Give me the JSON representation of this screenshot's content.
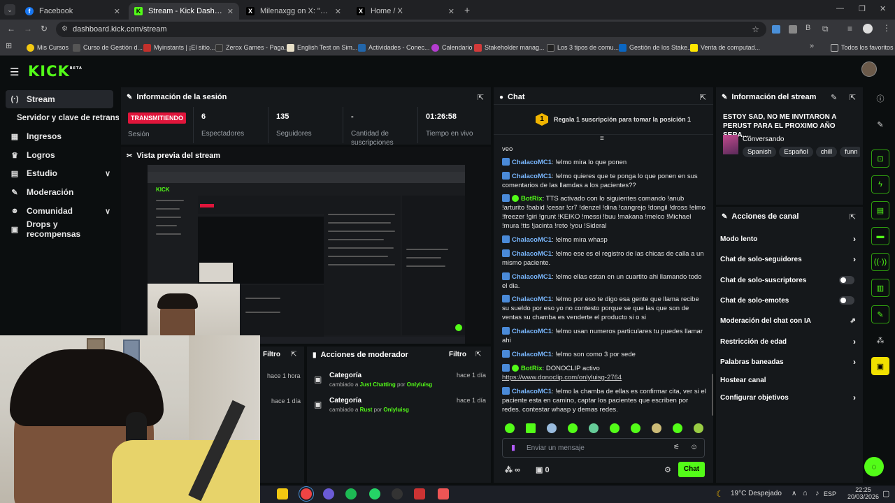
{
  "browser": {
    "tabs": [
      {
        "title": "Facebook",
        "color": "#1877f2",
        "glyph": "f"
      },
      {
        "title": "Stream - Kick Dashboard",
        "color": "#53fc18",
        "glyph": "K"
      },
      {
        "title": "Milenaxgg on X: \"Entrevista al...",
        "color": "#000000",
        "glyph": "X"
      },
      {
        "title": "Home / X",
        "color": "#000000",
        "glyph": "X"
      }
    ],
    "url": "dashboard.kick.com/stream",
    "bookmarks": [
      {
        "label": "Mis Cursos",
        "color": "#f2c811"
      },
      {
        "label": "Curso de Gestión d...",
        "color": "#555555"
      },
      {
        "label": "Myinstants | ¡El sitio...",
        "color": "#c4302b"
      },
      {
        "label": "Zerox Games - Paga...",
        "color": "#333333"
      },
      {
        "label": "English Test on Sim...",
        "color": "#e8e0c8"
      },
      {
        "label": "Actividades - Conec...",
        "color": "#2266aa"
      },
      {
        "label": "Calendario",
        "color": "#b43cd0"
      },
      {
        "label": "Stakeholder manag...",
        "color": "#d23a3a"
      },
      {
        "label": "Los 3 tipos de comu...",
        "color": "#222222"
      },
      {
        "label": "Gestión de los Stake...",
        "color": "#0a66c2"
      },
      {
        "label": "Venta de computad...",
        "color": "#ffe600"
      }
    ],
    "all_favorites": "Todos los favoritos"
  },
  "kick": {
    "logo": "KICK",
    "logo_badge": "BETA"
  },
  "sidebar": {
    "items": [
      {
        "label": "Stream",
        "icon": "(·)"
      },
      {
        "label": "Servidor y clave de retransmisión",
        "icon": ""
      },
      {
        "label": "Ingresos",
        "icon": "▦"
      },
      {
        "label": "Logros",
        "icon": "♛"
      },
      {
        "label": "Estudio",
        "icon": "▤"
      },
      {
        "label": "Moderación",
        "icon": "✎"
      },
      {
        "label": "Comunidad",
        "icon": "☻"
      },
      {
        "label": "Drops y recompensas",
        "icon": "▣"
      }
    ]
  },
  "session": {
    "title": "Información de la sesión",
    "status": "TRANSMITIENDO",
    "status_label": "Sesión",
    "stats": [
      {
        "value": "6",
        "label": "Espectadores"
      },
      {
        "value": "135",
        "label": "Seguidores"
      },
      {
        "value": "-",
        "label": "Cantidad de suscripciones"
      },
      {
        "value": "01:26:58",
        "label": "Tiempo en vivo"
      }
    ]
  },
  "preview": {
    "title": "Vista previa del stream"
  },
  "activity": {
    "filter": "Filtro",
    "times": [
      "hace 1 hora",
      "hace 1 día"
    ]
  },
  "mod_actions": {
    "title": "Acciones de moderador",
    "filter": "Filtro",
    "items": [
      {
        "title": "Categoría",
        "pre": "cambiado a",
        "category": "Just Chatting",
        "by": "por",
        "user": "Onlyluisg",
        "time": "hace 1 día"
      },
      {
        "title": "Categoría",
        "pre": "cambiado a",
        "category": "Rust",
        "by": "por",
        "user": "Onlyluisg",
        "time": "hace 1 día"
      }
    ]
  },
  "chat": {
    "title": "Chat",
    "gift_count": "1",
    "gift_text": "Regala 1 suscripción para tomar la posición 1",
    "first_fragment": "veo",
    "messages": [
      {
        "user": "ChalacoMC1",
        "bot": false,
        "text": ": !elmo mira lo que ponen"
      },
      {
        "user": "ChalacoMC1",
        "bot": false,
        "text": ": !elmo quieres que te ponga lo que ponen en sus comentarios de las llamdas a los pacientes??"
      },
      {
        "user": "BotRix",
        "bot": true,
        "text": ": TTS activado con lo siguientes comando !anub !arturito !babid !cesar !cr7 !denzel !dina !cangrejo !dongil !dross !elmo !freezer !giri !grunt !KEIKO !messi !buu !makana !melco !Michael !mura !tts !jacinta !reto !you !Sideral"
      },
      {
        "user": "ChalacoMC1",
        "bot": false,
        "text": ": !elmo mira whasp"
      },
      {
        "user": "ChalacoMC1",
        "bot": false,
        "text": ": !elmo ese es el registro de las chicas de calla a un mismo paciente."
      },
      {
        "user": "ChalacoMC1",
        "bot": false,
        "text": ": !elmo ellas estan en un cuartito ahi llamando todo el dia."
      },
      {
        "user": "ChalacoMC1",
        "bot": false,
        "text": ": !elmo por eso te digo esa gente que llama recibe su sueldo por eso yo no contesto porque se que las que son de ventas su chamba es venderte el producto si o si"
      },
      {
        "user": "ChalacoMC1",
        "bot": false,
        "text": ": !elmo usan numeros particulares tu puedes llamar ahi"
      },
      {
        "user": "ChalacoMC1",
        "bot": false,
        "text": ": !elmo son como 3 por sede"
      },
      {
        "user": "BotRix",
        "bot": true,
        "text": ": DONOCLIP activo",
        "link": "https://www.donoclip.com/onlyluisg-2764"
      },
      {
        "user": "ChalacoMC1",
        "bot": false,
        "text": ": !elmo la chamba de ellas es confirmar cita, ver si el paciente esta en camino, captar los pacientes que escriben por redes. contestar whasp y demas redes."
      }
    ],
    "input_placeholder": "Enviar un mensaje",
    "points": "∞",
    "gift_points": "0",
    "send_label": "Chat"
  },
  "stream_info": {
    "title": "Información del stream",
    "stream_title": "ESTOY SAD, NO ME INVITARON A PERUST PARA EL PROXIMO AÑO SERA.…",
    "category": "Conversando",
    "tags": [
      "Spanish",
      "Español",
      "chill",
      "funn"
    ]
  },
  "channel_actions": {
    "title": "Acciones de canal",
    "items": [
      {
        "label": "Modo lento",
        "kind": "arrow"
      },
      {
        "label": "Chat de solo-seguidores",
        "kind": "arrow"
      },
      {
        "label": "Chat de solo-suscriptores",
        "kind": "toggle"
      },
      {
        "label": "Chat de solo-emotes",
        "kind": "toggle"
      },
      {
        "label": "Moderación del chat con IA",
        "kind": "external"
      },
      {
        "label": "Restricción de edad",
        "kind": "arrow"
      },
      {
        "label": "Palabras baneadas",
        "kind": "arrow"
      },
      {
        "label": "Hostear canal",
        "kind": "none"
      },
      {
        "label": "Configurar objetivos",
        "kind": "arrow"
      }
    ]
  },
  "taskbar": {
    "weather": "19°C  Despejado",
    "lang": "ESP",
    "time": "22:25",
    "date": "20/03/2026"
  },
  "colors": {
    "kick_green": "#53fc18",
    "live_red": "#e0153b",
    "username_blue": "#7ab8ff"
  }
}
